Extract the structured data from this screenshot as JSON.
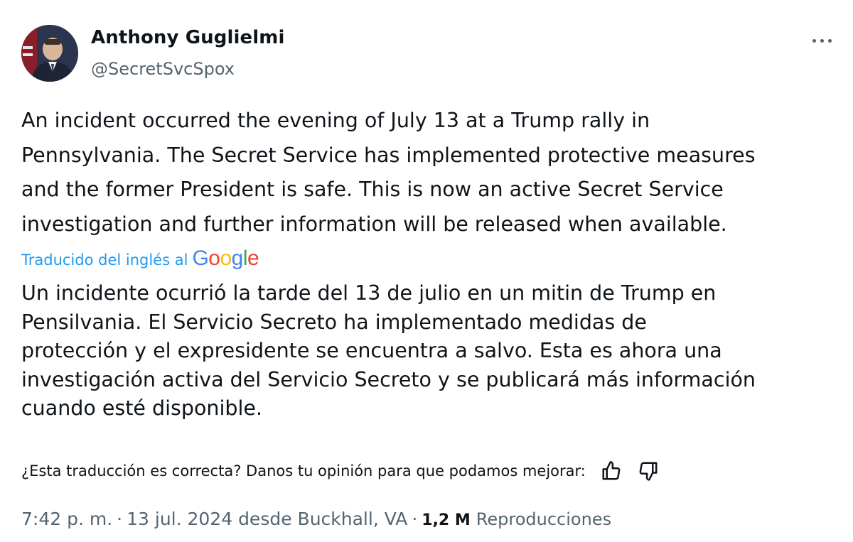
{
  "author": {
    "name": "Anthony Guglielmi",
    "handle": "@SecretSvcSpox",
    "avatar_icon": "profile-photo"
  },
  "tweet": {
    "original_lines": [
      "An incident occurred the evening of July 13 at a Trump rally in",
      "Pennsylvania. The Secret Service has implemented protective measures",
      "and the former President is safe. This is now an active Secret Service",
      "investigation and further information will be released when available."
    ],
    "translated_by_label": "Traducido del inglés al",
    "translator_brand": "Google",
    "translation_lines": [
      "Un incidente ocurrió la tarde del 13 de julio en un mitin de Trump en",
      "Pensilvania. El Servicio Secreto ha implementado medidas de",
      "protección y el expresidente se encuentra a salvo. Esta es ahora una",
      "investigación activa del Servicio Secreto y se publicará más información",
      "cuando esté disponible."
    ]
  },
  "feedback": {
    "question": "¿Esta traducción es correcta? Danos tu opinión para que podamos mejorar:",
    "thumbs_up_icon": "thumbs-up-icon",
    "thumbs_down_icon": "thumbs-down-icon"
  },
  "meta": {
    "time": "7:42 p. m.",
    "separator": "·",
    "date_location": "13 jul. 2024 desde Buckhall, VA",
    "views_count": "1,2 M",
    "views_label": "Reproducciones"
  },
  "colors": {
    "text_primary": "#0f1419",
    "text_secondary": "#536471",
    "link_blue": "#1d9bf0"
  }
}
